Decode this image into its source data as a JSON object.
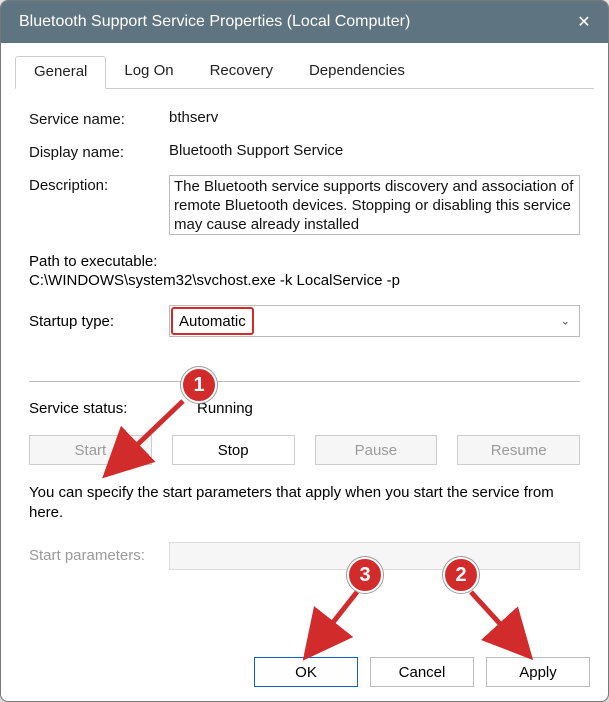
{
  "window": {
    "title": "Bluetooth Support Service Properties (Local Computer)",
    "close_icon": "✕"
  },
  "tabs": [
    "General",
    "Log On",
    "Recovery",
    "Dependencies"
  ],
  "active_tab": "General",
  "general": {
    "service_name_label": "Service name:",
    "service_name": "bthserv",
    "display_name_label": "Display name:",
    "display_name": "Bluetooth Support Service",
    "description_label": "Description:",
    "description": "The Bluetooth service supports discovery and association of remote Bluetooth devices.  Stopping or disabling this service may cause already installed",
    "path_label": "Path to executable:",
    "path_value": "C:\\WINDOWS\\system32\\svchost.exe -k LocalService -p",
    "startup_label": "Startup type:",
    "startup_value": "Automatic",
    "status_label": "Service status:",
    "status_value": "Running",
    "buttons": {
      "start": "Start",
      "stop": "Stop",
      "pause": "Pause",
      "resume": "Resume"
    },
    "hint": "You can specify the start parameters that apply when you start the service from here.",
    "params_label": "Start parameters:",
    "params_value": ""
  },
  "footer": {
    "ok": "OK",
    "cancel": "Cancel",
    "apply": "Apply"
  },
  "annotations": {
    "b1": "1",
    "b2": "2",
    "b3": "3"
  },
  "colors": {
    "annotation": "#d22b2b",
    "titlebar": "#5f7481",
    "primary_border": "#0a62c9"
  }
}
